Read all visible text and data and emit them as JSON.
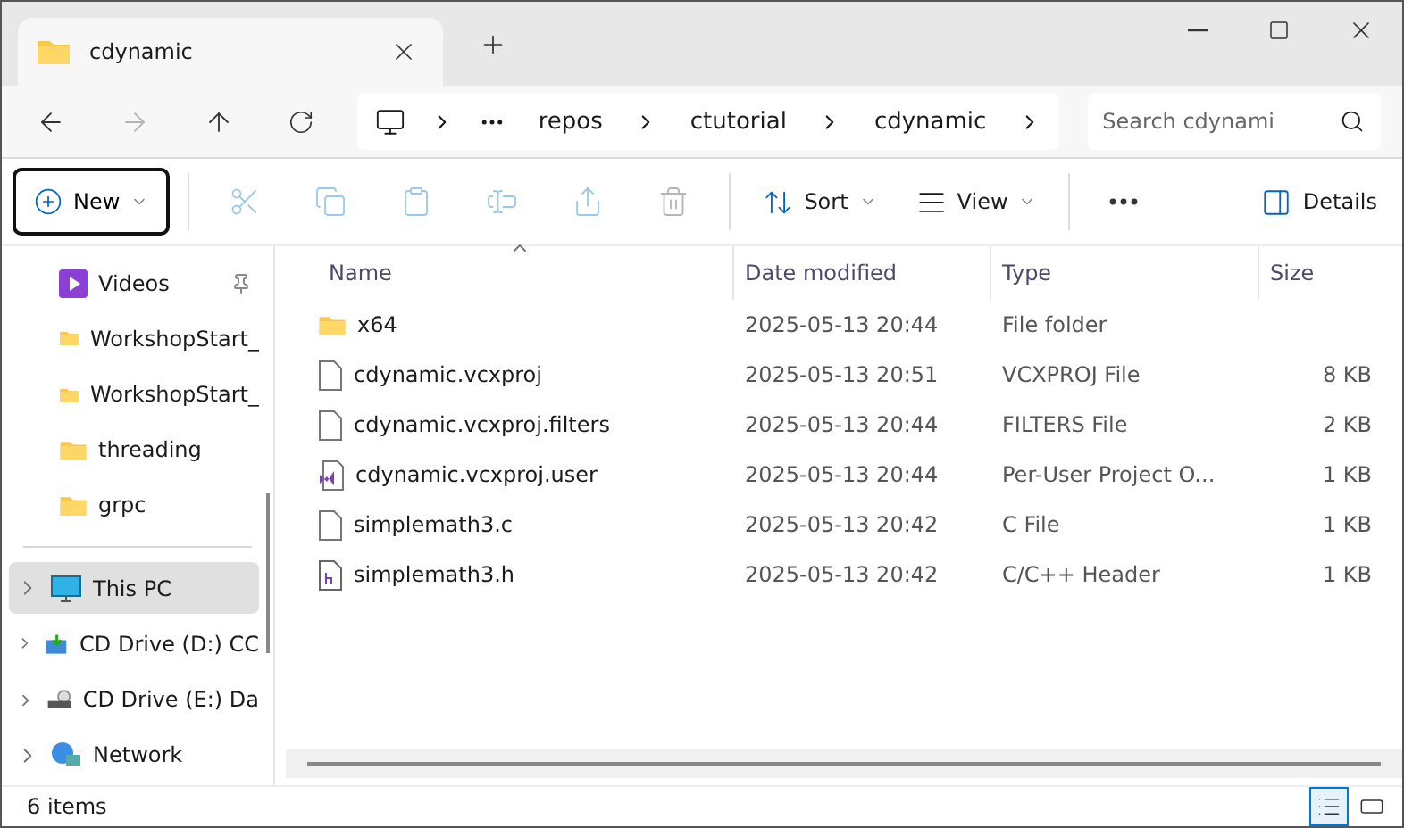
{
  "tab": {
    "title": "cdynamic"
  },
  "breadcrumb": [
    "repos",
    "ctutorial",
    "cdynamic"
  ],
  "search": {
    "placeholder": "Search cdynami"
  },
  "toolbar": {
    "new": {
      "label": "New",
      "focused": true
    },
    "actions": [
      {
        "disabled": true
      },
      {
        "disabled": true
      },
      {
        "disabled": true
      },
      {
        "disabled": true
      },
      {
        "disabled": true
      },
      {
        "disabled": true
      }
    ],
    "sort": {
      "label": "Sort"
    },
    "view": {
      "label": "View"
    },
    "details": {
      "label": "Details"
    }
  },
  "sidebar": {
    "items": [
      {
        "kind": "videos",
        "label": "Videos",
        "pinned": true,
        "expandable": false,
        "selected": false
      },
      {
        "kind": "folder",
        "label": "WorkshopStart_",
        "pinned": false,
        "expandable": false,
        "selected": false
      },
      {
        "kind": "folder",
        "label": "WorkshopStart_",
        "pinned": false,
        "expandable": false,
        "selected": false
      },
      {
        "kind": "folder",
        "label": "threading",
        "pinned": false,
        "expandable": false,
        "selected": false
      },
      {
        "kind": "folder",
        "label": "grpc",
        "pinned": false,
        "expandable": false,
        "selected": false
      },
      {
        "kind": "divider"
      },
      {
        "kind": "pc",
        "label": "This PC",
        "pinned": false,
        "expandable": true,
        "selected": true
      },
      {
        "kind": "cd",
        "label": "CD Drive (D:) CC",
        "pinned": false,
        "expandable": true,
        "selected": false
      },
      {
        "kind": "drive",
        "label": "CD Drive (E:) Da",
        "pinned": false,
        "expandable": true,
        "selected": false
      },
      {
        "kind": "network",
        "label": "Network",
        "pinned": false,
        "expandable": true,
        "selected": false
      }
    ]
  },
  "table": {
    "columns": [
      {
        "label": "Name",
        "sorted": true
      },
      {
        "label": "Date modified",
        "sorted": false
      },
      {
        "label": "Type",
        "sorted": false
      },
      {
        "label": "Size",
        "sorted": false
      }
    ],
    "rows": [
      {
        "kind": "folder",
        "name": "x64",
        "date": "2025-05-13 20:44",
        "type": "File folder"
      },
      {
        "kind": "file",
        "name": "cdynamic.vcxproj",
        "date": "2025-05-13 20:51",
        "type": "VCXPROJ File",
        "size": "8 KB"
      },
      {
        "kind": "file",
        "name": "cdynamic.vcxproj.filters",
        "date": "2025-05-13 20:44",
        "type": "FILTERS File",
        "size": "2 KB"
      },
      {
        "kind": "vs",
        "name": "cdynamic.vcxproj.user",
        "date": "2025-05-13 20:44",
        "type": "Per-User Project O...",
        "size": "1 KB"
      },
      {
        "kind": "file",
        "name": "simplemath3.c",
        "date": "2025-05-13 20:42",
        "type": "C File",
        "size": "1 KB"
      },
      {
        "kind": "header",
        "name": "simplemath3.h",
        "date": "2025-05-13 20:42",
        "type": "C/C++ Header",
        "size": "1 KB"
      }
    ]
  },
  "status_bar": {
    "count": "6 items",
    "views": [
      {
        "kind": "details",
        "selected": true
      },
      {
        "kind": "tiles",
        "selected": false
      }
    ]
  }
}
